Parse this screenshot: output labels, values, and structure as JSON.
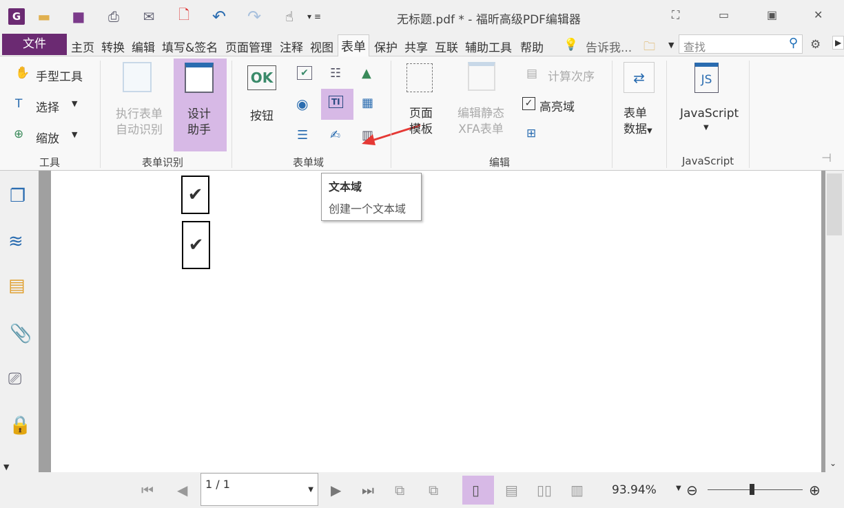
{
  "window": {
    "title": "无标题.pdf * - 福昕高级PDF编辑器"
  },
  "menu": {
    "file": "文件",
    "tabs": [
      "主页",
      "转换",
      "编辑",
      "填写&签名",
      "页面管理",
      "注释",
      "视图",
      "表单",
      "保护",
      "共享",
      "互联",
      "辅助工具",
      "帮助"
    ],
    "active_tab": "表单",
    "tell_me": "告诉我...",
    "search_placeholder": "查找"
  },
  "ribbon": {
    "tools": {
      "hand": "手型工具",
      "select": "选择",
      "zoom": "缩放",
      "label": "工具"
    },
    "form_recognition": {
      "run": [
        "执行表单",
        "自动识别"
      ],
      "design": [
        "设计",
        "助手"
      ],
      "label": "表单识别"
    },
    "form_fields": {
      "button": "按钮",
      "label": "表单域"
    },
    "edit": {
      "page_template": [
        "页面",
        "模板"
      ],
      "edit_xfa": [
        "编辑静态",
        "XFA表单"
      ],
      "calc_order": "计算次序",
      "highlight": "高亮域",
      "label": "编辑"
    },
    "form_data": [
      "表单",
      "数据"
    ],
    "javascript": {
      "button": "JavaScript",
      "label": "JavaScript"
    }
  },
  "tooltip": {
    "title": "文本域",
    "desc": "创建一个文本域"
  },
  "document": {
    "checkmarks": [
      "✔",
      "✔"
    ]
  },
  "statusbar": {
    "page": "1 / 1",
    "zoom": "93.94%"
  },
  "colors": {
    "accent": "#6b2a72",
    "highlight": "#d7b9e6",
    "arrow": "#e53935"
  }
}
